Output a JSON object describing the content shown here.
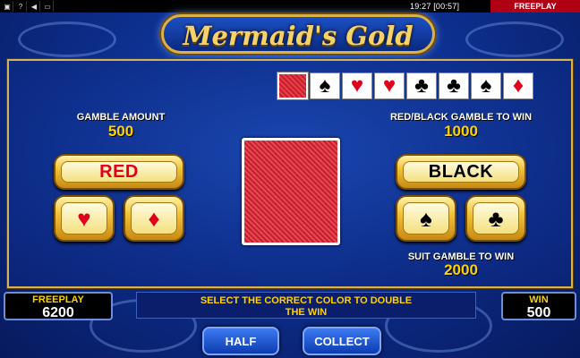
{
  "topbar": {
    "icons": [
      "flag-icon",
      "help-icon",
      "sound-icon",
      "fullscreen-icon"
    ],
    "icon_glyphs": [
      "▣",
      "?",
      "◀",
      "▭"
    ],
    "clock": "19:27 [00:57]",
    "mode": "FREEPLAY"
  },
  "title": "Mermaid's Gold",
  "history": [
    {
      "type": "back"
    },
    {
      "suit": "♠",
      "color": "black"
    },
    {
      "suit": "♥",
      "color": "red"
    },
    {
      "suit": "♥",
      "color": "red"
    },
    {
      "suit": "♣",
      "color": "black"
    },
    {
      "suit": "♣",
      "color": "black"
    },
    {
      "suit": "♠",
      "color": "black"
    },
    {
      "suit": "♦",
      "color": "red"
    }
  ],
  "gamble": {
    "amount_label": "GAMBLE AMOUNT",
    "amount": "500",
    "redblack_label": "RED/BLACK GAMBLE TO WIN",
    "redblack_value": "1000",
    "suit_label": "SUIT GAMBLE TO WIN",
    "suit_value": "2000"
  },
  "buttons": {
    "red": "RED",
    "black": "BLACK",
    "hearts": "♥",
    "diamonds": "♦",
    "spades": "♠",
    "clubs": "♣",
    "half": "HALF",
    "collect": "COLLECT"
  },
  "freeplay": {
    "label": "FREEPLAY",
    "value": "6200"
  },
  "win": {
    "label": "WIN",
    "value": "500"
  },
  "message": {
    "line1": "SELECT THE CORRECT COLOR TO DOUBLE",
    "line2": "THE WIN"
  },
  "colors": {
    "red_suit": "#e0001b",
    "gold": "#ffd200",
    "frame_gold": "#d8b24a"
  }
}
